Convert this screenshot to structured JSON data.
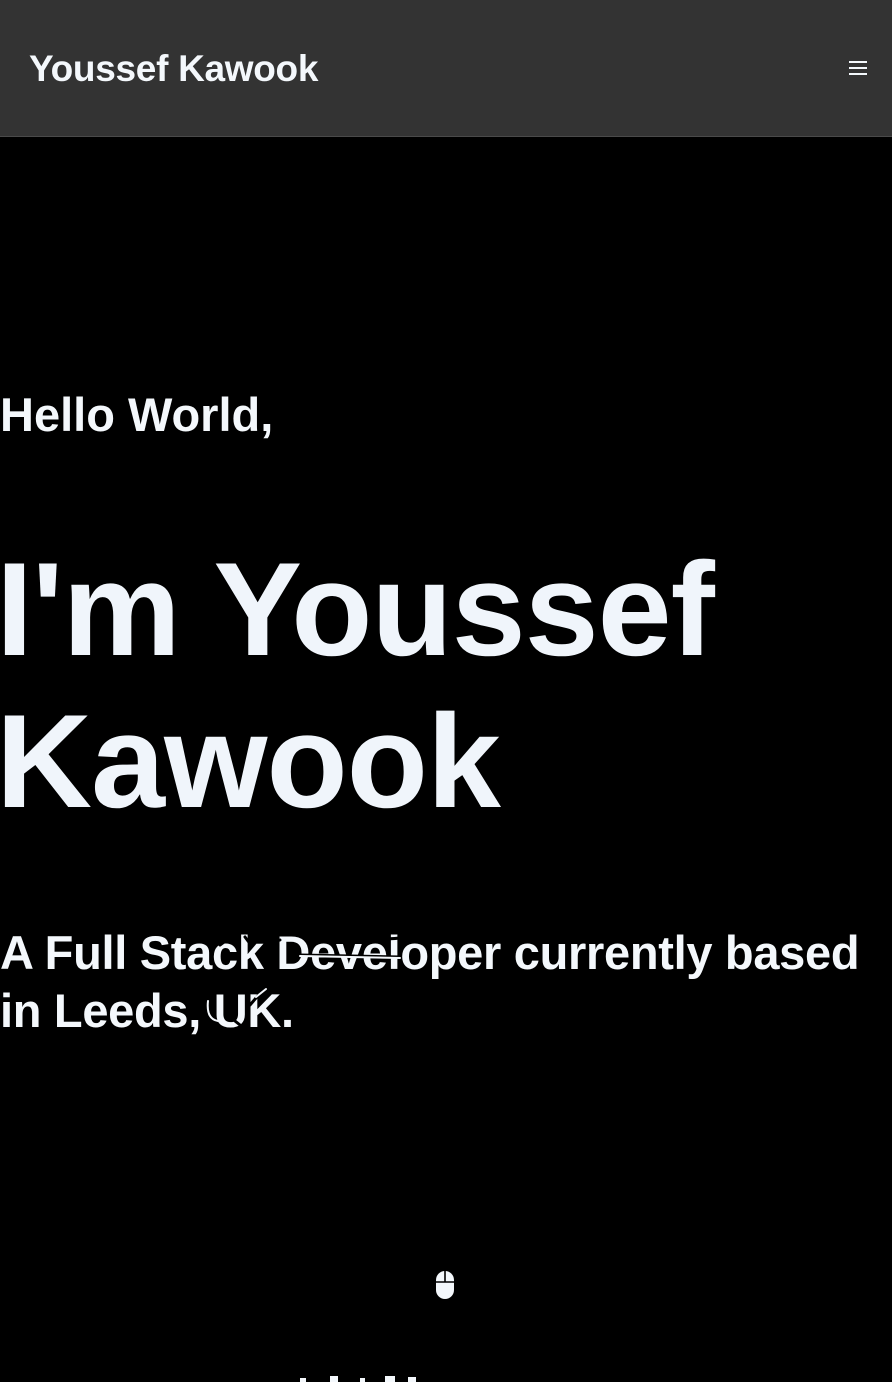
{
  "header": {
    "brand": "Youssef Kawook",
    "menu_icon": "hamburger-menu-icon"
  },
  "hero": {
    "greeting": "Hello World,",
    "name_line1": "I'm Youssef",
    "name_line2": "Kawook",
    "tagline": "A Full Stack Developer currently based in Leeds, UK.",
    "scroll_icon": "mouse-scroll-icon"
  },
  "colors": {
    "navbar_bg": "#333333",
    "page_bg": "#000000",
    "text": "#f4f8fc"
  }
}
